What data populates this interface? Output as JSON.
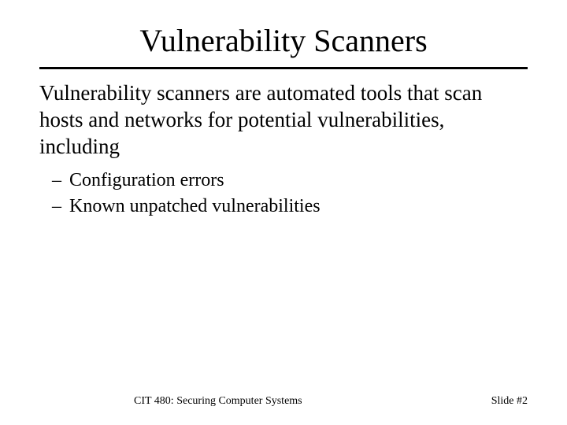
{
  "title": "Vulnerability Scanners",
  "body": "Vulnerability scanners are automated tools that scan hosts and networks for potential vulnerabilities, including",
  "bullets": [
    "Configuration errors",
    "Known unpatched vulnerabilities"
  ],
  "footer": {
    "left": "CIT 480: Securing Computer Systems",
    "right": "Slide #2"
  }
}
